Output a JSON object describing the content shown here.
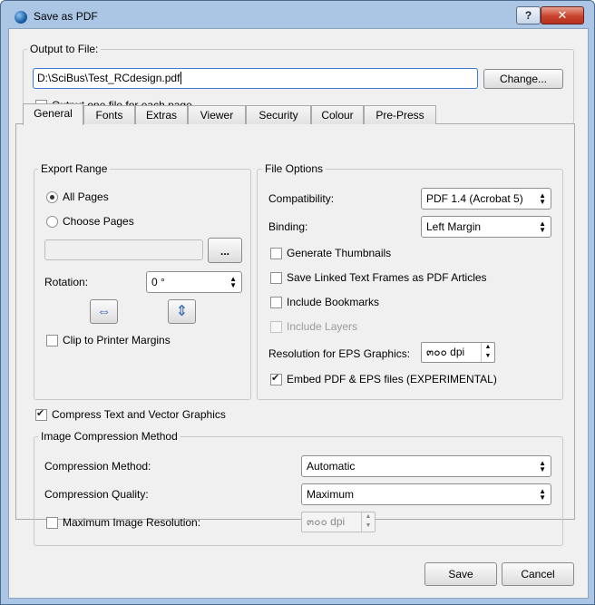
{
  "window": {
    "title": "Save as PDF",
    "help_label": "?",
    "close_label": "✕"
  },
  "output": {
    "group_label": "Output to File:",
    "file_path": "D:\\SciBus\\Test_RCdesign.pdf",
    "change_label": "Change...",
    "one_file_label": "Output one file for each page",
    "one_file_checked": false
  },
  "tabs": [
    {
      "label": "General",
      "active": true
    },
    {
      "label": "Fonts"
    },
    {
      "label": "Extras"
    },
    {
      "label": "Viewer"
    },
    {
      "label": "Security"
    },
    {
      "label": "Colour"
    },
    {
      "label": "Pre-Press"
    }
  ],
  "export_range": {
    "group_label": "Export Range",
    "all_pages_label": "All Pages",
    "choose_pages_label": "Choose Pages",
    "selected": "All Pages",
    "pages_value": "",
    "browse_label": "...",
    "rotation_label": "Rotation:",
    "rotation_value": "0 °",
    "clip_label": "Clip to Printer Margins",
    "clip_checked": false
  },
  "file_options": {
    "group_label": "File Options",
    "compatibility_label": "Compatibility:",
    "compatibility_value": "PDF 1.4 (Acrobat 5)",
    "binding_label": "Binding:",
    "binding_value": "Left Margin",
    "thumbnails_label": "Generate Thumbnails",
    "linked_frames_label": "Save Linked Text Frames as PDF Articles",
    "bookmarks_label": "Include Bookmarks",
    "layers_label": "Include Layers",
    "eps_res_label": "Resolution for EPS Graphics:",
    "eps_res_value": "๓๐๐ dpi",
    "embed_label": "Embed PDF & EPS files (EXPERIMENTAL)",
    "embed_checked": true
  },
  "compress_text_label": "Compress Text and Vector Graphics",
  "compress_text_checked": true,
  "image_compression": {
    "group_label": "Image Compression Method",
    "method_label": "Compression Method:",
    "method_value": "Automatic",
    "quality_label": "Compression Quality:",
    "quality_value": "Maximum",
    "max_res_label": "Maximum Image Resolution:",
    "max_res_value": "๓๐๐ dpi",
    "max_res_checked": false
  },
  "buttons": {
    "save_label": "Save",
    "cancel_label": "Cancel"
  },
  "colors": {
    "frame": "#aac6e4",
    "dialog_bg": "#f0f0f0",
    "input_focus": "#3a7bd5",
    "close": "#c8432c"
  }
}
